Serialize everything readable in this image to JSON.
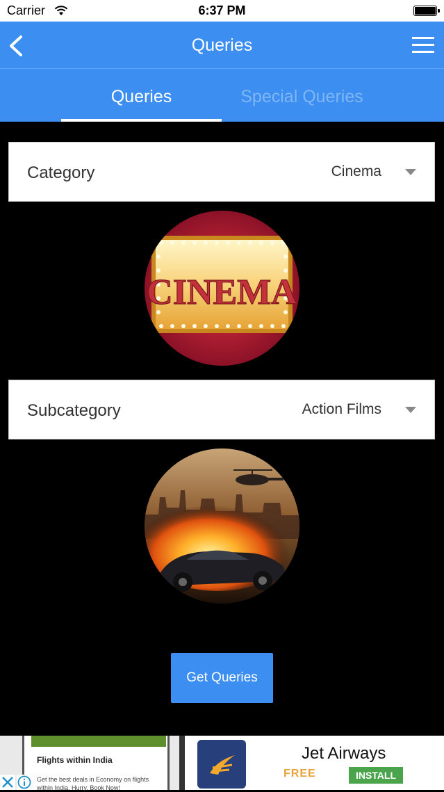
{
  "status_bar": {
    "carrier": "Carrier",
    "time": "6:37 PM"
  },
  "navbar": {
    "title": "Queries"
  },
  "tabs": [
    {
      "label": "Queries",
      "active": true
    },
    {
      "label": "Special Queries",
      "active": false
    }
  ],
  "category": {
    "label": "Category",
    "value": "Cinema",
    "image_text": "CINEMA"
  },
  "subcategory": {
    "label": "Subcategory",
    "value": "Action Films"
  },
  "actions": {
    "get_queries": "Get Queries"
  },
  "ad": {
    "left_title": "Flights within India",
    "left_text": "Get the best deals in Economy on flights within India. Hurry, Book Now!",
    "brand": "Jet Airways",
    "free_label": "FREE",
    "install_label": "INSTALL"
  },
  "colors": {
    "accent": "#3c8ef0",
    "background": "#000000",
    "install": "#4aa44b"
  }
}
